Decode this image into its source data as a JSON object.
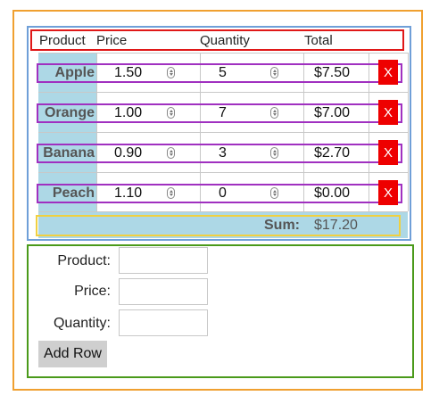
{
  "table": {
    "headers": [
      "Product",
      "Price",
      "Quantity",
      "Total"
    ],
    "rows": [
      {
        "product": "Apple",
        "price": "1.50",
        "quantity": "5",
        "total": "$7.50",
        "delete_label": "X"
      },
      {
        "product": "Orange",
        "price": "1.00",
        "quantity": "7",
        "total": "$7.00",
        "delete_label": "X"
      },
      {
        "product": "Banana",
        "price": "0.90",
        "quantity": "3",
        "total": "$2.70",
        "delete_label": "X"
      },
      {
        "product": "Peach",
        "price": "1.10",
        "quantity": "0",
        "total": "$0.00",
        "delete_label": "X"
      }
    ],
    "sum_label": "Sum:",
    "sum_value": "$17.20"
  },
  "form": {
    "product_label": "Product:",
    "product_value": "",
    "price_label": "Price:",
    "price_value": "",
    "quantity_label": "Quantity:",
    "quantity_value": "",
    "add_button_label": "Add Row"
  },
  "colors": {
    "outer_border": "#f0a030",
    "table_border": "#6f9fd8",
    "form_border": "#4a9a1a",
    "header_border": "#e01818",
    "row_border": "#a030c0",
    "sum_border": "#f0d040",
    "name_column_bg": "#add8e6",
    "delete_button_bg": "#ee0000"
  }
}
